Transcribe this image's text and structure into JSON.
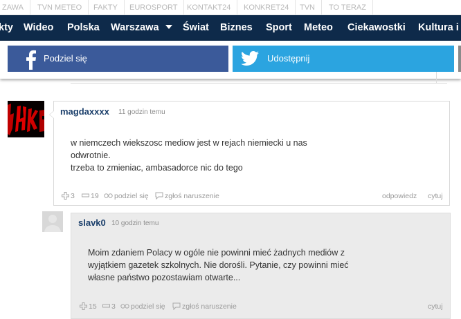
{
  "topbar": {
    "links": [
      "ZAWA",
      "TVN METEO",
      "FAKTY",
      "EUROSPORT",
      "KONTAKT24",
      "KONKRET24",
      "TVN",
      "TO TERAZ"
    ]
  },
  "nav": {
    "items": [
      "kty",
      "Wideo",
      "Polska",
      "Warszawa",
      "Świat",
      "Biznes",
      "Sport",
      "Meteo",
      "Ciekawostki",
      "Kultura i"
    ]
  },
  "share": {
    "facebook_label": "Podziel się",
    "twitter_label": "Udostępnij",
    "facebook_color": "#3b5a9a",
    "twitter_color": "#2ba4e0"
  },
  "comments": [
    {
      "user": "magdaxxxx",
      "time": "11 godzin temu",
      "lines": [
        "w niemczech wiekszosc mediow jest w rejach niemiecki u nas",
        "odwrotnie.",
        "trzeba to zmieniac, ambasadorce nic do tego"
      ],
      "likes": "3",
      "dislikes": "19",
      "share_label": "podziel się",
      "report_label": "zgłoś naruszenie",
      "reply_label": "odpowiedz",
      "quote_label": "cytuj"
    },
    {
      "user": "slavk0",
      "time": "10 godzin temu",
      "lines": [
        "Moim zdaniem Polacy w ogóle nie powinni mieć żadnych mediów z",
        "wyjątkiem gazetek szkolnych. Nie dorośli. Pytanie, czy powinni mieć",
        "własne państwo pozostawiam otwarte..."
      ],
      "likes": "15",
      "dislikes": "3",
      "share_label": "podziel się",
      "report_label": "zgłoś naruszenie",
      "quote_label": "cytuj"
    }
  ]
}
